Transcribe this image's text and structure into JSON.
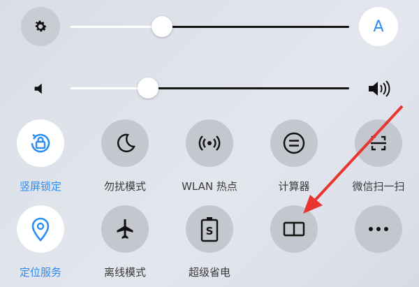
{
  "brightness": {
    "auto_label": "A",
    "level": 0.33
  },
  "volume": {
    "level": 0.28
  },
  "tiles": [
    {
      "label": "竖屏锁定",
      "icon": "rotation-lock-icon",
      "active": true
    },
    {
      "label": "勿扰模式",
      "icon": "moon-icon",
      "active": false
    },
    {
      "label": "WLAN 热点",
      "icon": "hotspot-icon",
      "active": false
    },
    {
      "label": "计算器",
      "icon": "calculator-icon",
      "active": false
    },
    {
      "label": "微信扫一扫",
      "icon": "scan-icon",
      "active": false
    },
    {
      "label": "定位服务",
      "icon": "location-pin-icon",
      "active": true
    },
    {
      "label": "离线模式",
      "icon": "airplane-icon",
      "active": false
    },
    {
      "label": "超级省电",
      "icon": "battery-saver-icon",
      "active": false
    },
    {
      "label": "",
      "icon": "book-icon",
      "active": false
    },
    {
      "label": "",
      "icon": "more-icon",
      "active": false
    }
  ],
  "colors": {
    "accent": "#2d8cf0",
    "arrow": "#e8352f"
  }
}
